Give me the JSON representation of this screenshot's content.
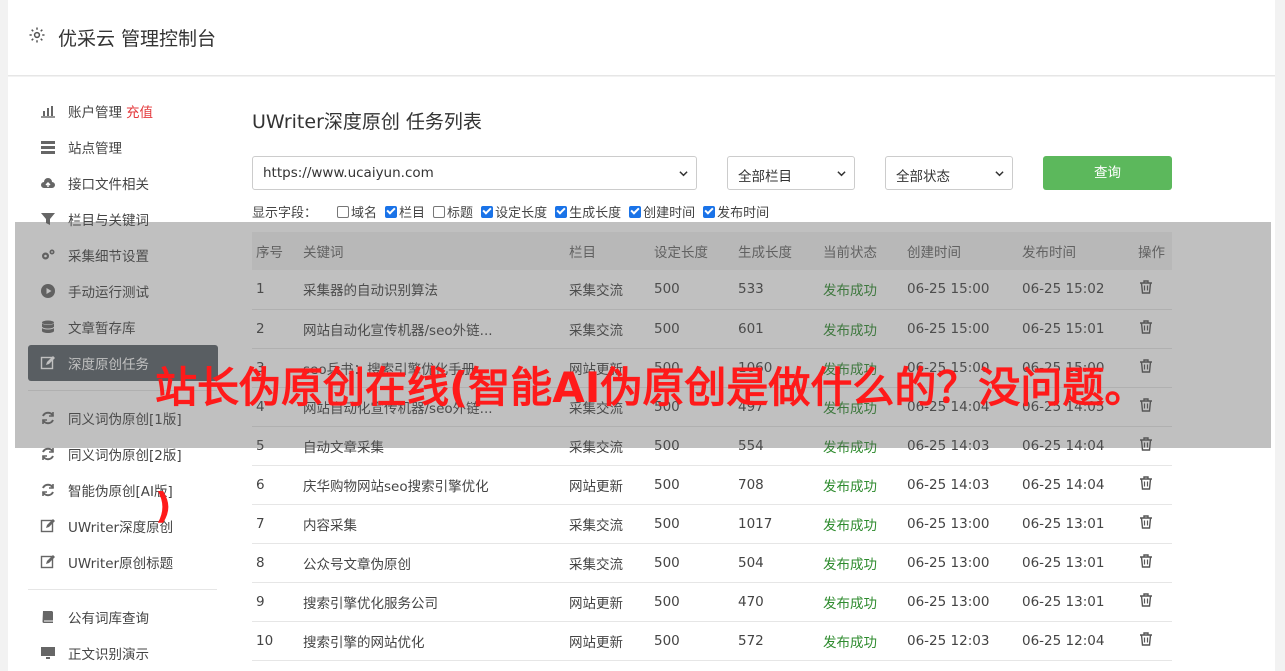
{
  "app": {
    "title": "优采云 管理控制台"
  },
  "sidebar": {
    "items": [
      {
        "label": "账户管理",
        "badge": "充值",
        "icon": "bar-chart-icon"
      },
      {
        "label": "站点管理",
        "icon": "server-icon"
      },
      {
        "label": "接口文件相关",
        "icon": "cloud-upload-icon"
      },
      {
        "label": "栏目与关键词",
        "icon": "filter-icon"
      },
      {
        "label": "采集细节设置",
        "icon": "gears-icon"
      },
      {
        "label": "手动运行测试",
        "icon": "play-circle-icon"
      },
      {
        "label": "文章暂存库",
        "icon": "database-icon"
      },
      {
        "label": "深度原创任务",
        "icon": "edit-icon",
        "active": true
      },
      {
        "label": "同义词伪原创[1版]",
        "icon": "refresh-icon"
      },
      {
        "label": "同义词伪原创[2版]",
        "icon": "refresh-icon"
      },
      {
        "label": "智能伪原创[AI版]",
        "icon": "refresh-icon"
      },
      {
        "label": "UWriter深度原创",
        "icon": "edit-icon"
      },
      {
        "label": "UWriter原创标题",
        "icon": "edit-icon"
      },
      {
        "label": "公有词库查询",
        "icon": "book-icon"
      },
      {
        "label": "正文识别演示",
        "icon": "monitor-icon"
      }
    ]
  },
  "main": {
    "title": "UWriter深度原创 任务列表",
    "site_select": "https://www.ucaiyun.com",
    "column_select": "全部栏目",
    "status_select": "全部状态",
    "query_label": "查询",
    "fields_label": "显示字段：",
    "fields": [
      {
        "label": "域名",
        "checked": false
      },
      {
        "label": "栏目",
        "checked": true
      },
      {
        "label": "标题",
        "checked": false
      },
      {
        "label": "设定长度",
        "checked": true
      },
      {
        "label": "生成长度",
        "checked": true
      },
      {
        "label": "创建时间",
        "checked": true
      },
      {
        "label": "发布时间",
        "checked": true
      }
    ]
  },
  "table": {
    "headers": [
      "序号",
      "关键词",
      "栏目",
      "设定长度",
      "生成长度",
      "当前状态",
      "创建时间",
      "发布时间",
      "操作"
    ],
    "rows": [
      [
        "1",
        "采集器的自动识别算法",
        "采集交流",
        "500",
        "533",
        "发布成功",
        "06-25 15:00",
        "06-25 15:02"
      ],
      [
        "2",
        "网站自动化宣传机器/seo外链...",
        "采集交流",
        "500",
        "601",
        "发布成功",
        "06-25 15:00",
        "06-25 15:01"
      ],
      [
        "3",
        "seo兵书：搜索引擎优化手册",
        "网站更新",
        "500",
        "1060",
        "发布成功",
        "06-25 15:00",
        "06-25 15:00"
      ],
      [
        "4",
        "网站自动化宣传机器/seo外链...",
        "采集交流",
        "500",
        "497",
        "发布成功",
        "06-25 14:04",
        "06-25 14:05"
      ],
      [
        "5",
        "自动文章采集",
        "采集交流",
        "500",
        "554",
        "发布成功",
        "06-25 14:03",
        "06-25 14:04"
      ],
      [
        "6",
        "庆华购物网站seo搜索引擎优化",
        "网站更新",
        "500",
        "708",
        "发布成功",
        "06-25 14:03",
        "06-25 14:04"
      ],
      [
        "7",
        "内容采集",
        "采集交流",
        "500",
        "1017",
        "发布成功",
        "06-25 13:00",
        "06-25 13:01"
      ],
      [
        "8",
        "公众号文章伪原创",
        "采集交流",
        "500",
        "504",
        "发布成功",
        "06-25 13:00",
        "06-25 13:01"
      ],
      [
        "9",
        "搜索引擎优化服务公司",
        "网站更新",
        "500",
        "470",
        "发布成功",
        "06-25 13:00",
        "06-25 13:01"
      ],
      [
        "10",
        "搜索引擎的网站优化",
        "网站更新",
        "500",
        "572",
        "发布成功",
        "06-25 12:03",
        "06-25 12:04"
      ]
    ]
  },
  "overlay": {
    "caption_line1": "站长伪原创在线(智能AI伪原创是做什么的？没问题。",
    "caption_line2": ")"
  },
  "colors": {
    "accent_green": "#5cb85c",
    "status_green": "#2e8b2e",
    "active_nav": "#5a6268",
    "caption_red": "#ff1a1a"
  }
}
